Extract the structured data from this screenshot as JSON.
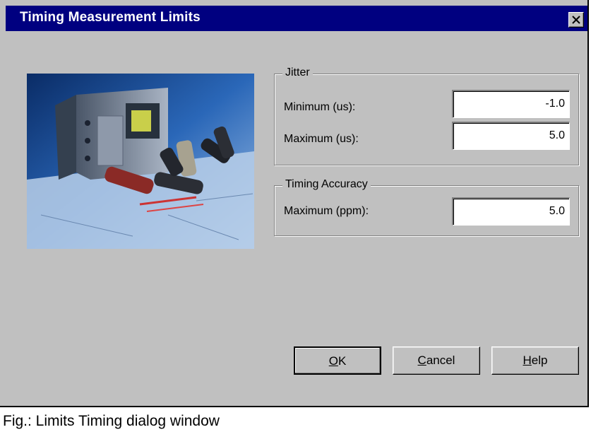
{
  "window": {
    "title": "Timing Measurement Limits"
  },
  "jitter": {
    "legend": "Jitter",
    "minimum_label": "Minimum (us):",
    "minimum_value": "-1.0",
    "maximum_label": "Maximum (us):",
    "maximum_value": "5.0"
  },
  "timing_accuracy": {
    "legend": "Timing Accuracy",
    "maximum_label": "Maximum (ppm):",
    "maximum_value": "5.0"
  },
  "buttons": {
    "ok_mn": "O",
    "ok_rest": "K",
    "cancel_mn": "C",
    "cancel_rest": "ancel",
    "help_mn": "H",
    "help_rest": "elp"
  },
  "caption": "Fig.: Limits Timing dialog window",
  "icons": {
    "close": "close-icon",
    "photo": "test-equipment-photo"
  },
  "colors": {
    "titlebar": "#000080",
    "dialog": "#c0c0c0"
  }
}
